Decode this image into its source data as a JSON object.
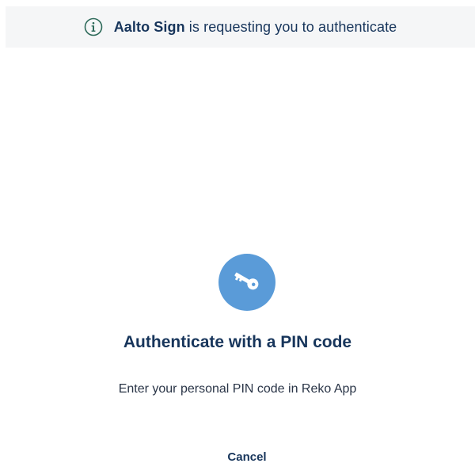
{
  "banner": {
    "app_name": "Aalto Sign",
    "message": " is requesting you to authenticate",
    "icon": "info-icon"
  },
  "auth": {
    "icon": "key-icon",
    "title": "Authenticate with a PIN code",
    "instruction": "Enter your personal PIN code in Reko App"
  },
  "actions": {
    "cancel_label": "Cancel"
  },
  "colors": {
    "primary_text": "#17355b",
    "icon_circle": "#5a9bd8",
    "banner_bg": "#f5f6f7"
  }
}
